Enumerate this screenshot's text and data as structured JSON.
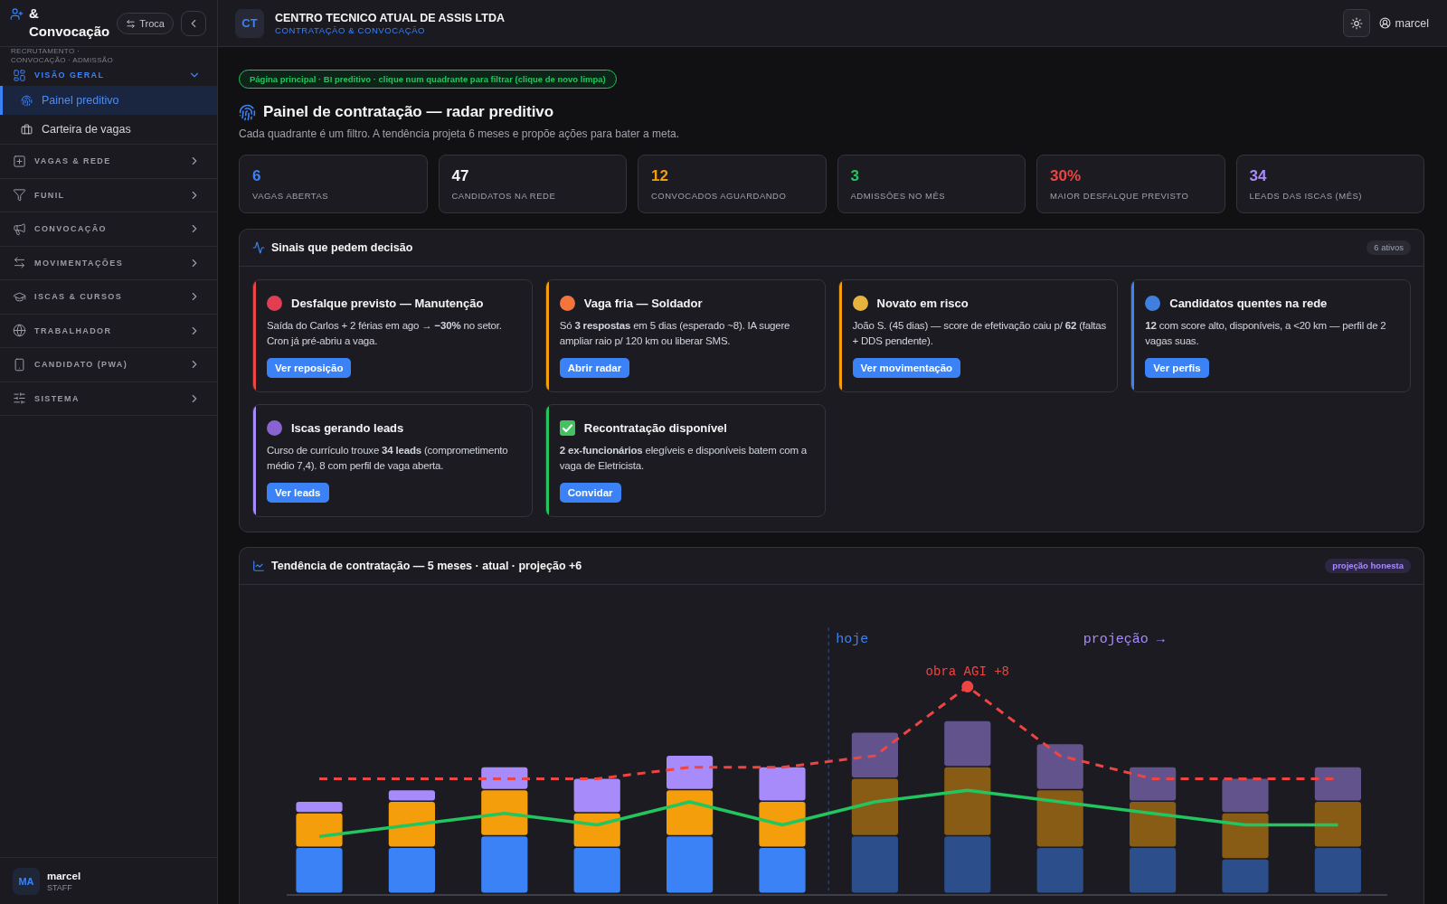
{
  "sidebar": {
    "title": "& Convocação",
    "subtitle": "RECRUTAMENTO · CONVOCAÇÃO · ADMISSÃO",
    "switch_button": "Troca",
    "groups": [
      {
        "label": "VISÃO GERAL",
        "expanded": true,
        "children": [
          {
            "label": "Painel preditivo",
            "selected": true
          },
          {
            "label": "Carteira de vagas",
            "selected": false
          }
        ]
      },
      {
        "label": "VAGAS & REDE",
        "expanded": false
      },
      {
        "label": "FUNIL",
        "expanded": false
      },
      {
        "label": "CONVOCAÇÃO",
        "expanded": false
      },
      {
        "label": "MOVIMENTAÇÕES",
        "expanded": false
      },
      {
        "label": "ISCAS & CURSOS",
        "expanded": false
      },
      {
        "label": "TRABALHADOR",
        "expanded": false
      },
      {
        "label": "CANDIDATO (PWA)",
        "expanded": false
      },
      {
        "label": "SISTEMA",
        "expanded": false
      }
    ],
    "user": {
      "initials": "MA",
      "name": "marcel",
      "role": "STAFF"
    }
  },
  "topbar": {
    "initials": "CT",
    "company": "CENTRO TECNICO ATUAL DE ASSIS LTDA",
    "module": "CONTRATAÇÃO & CONVOCAÇÃO",
    "user": "marcel"
  },
  "page": {
    "breadcrumb": "Página principal · BI preditivo · clique num quadrante para filtrar (clique de novo limpa)",
    "title": "Painel de contratação — radar preditivo",
    "subtitle": "Cada quadrante é um filtro. A tendência projeta 6 meses e propõe ações para bater a meta."
  },
  "stats": [
    {
      "value": "6",
      "label": "VAGAS ABERTAS",
      "color": "#3b82f6"
    },
    {
      "value": "47",
      "label": "CANDIDATOS NA REDE",
      "color": "#f4f4f5"
    },
    {
      "value": "12",
      "label": "CONVOCADOS AGUARDANDO",
      "color": "#f59e0b"
    },
    {
      "value": "3",
      "label": "ADMISSÕES NO MÊS",
      "color": "#22c55e"
    },
    {
      "value": "30%",
      "label": "MAIOR DESFALQUE PREVISTO",
      "color": "#ef4444"
    },
    {
      "value": "34",
      "label": "LEADS DAS ISCAS (MÊS)",
      "color": "#a78bfa"
    }
  ],
  "signals": {
    "title": "Sinais que pedem decisão",
    "badge": "6 ativos",
    "cards": [
      {
        "color": "#ef4444",
        "icon": {
          "kind": "dot",
          "color": "#e23d50"
        },
        "title": "Desfalque previsto — Manutenção",
        "text": "Saída do Carlos + 2 férias em ago → **−30%** no setor. Cron já pré-abriu a vaga.",
        "action": "Ver reposição"
      },
      {
        "color": "#f59e0b",
        "icon": {
          "kind": "dot",
          "color": "#f4743b"
        },
        "title": "Vaga fria — Soldador",
        "text": "Só **3 respostas** em 5 dias (esperado ~8). IA sugere ampliar raio p/ 120 km ou liberar SMS.",
        "action": "Abrir radar"
      },
      {
        "color": "#f59e0b",
        "icon": {
          "kind": "dot",
          "color": "#e8b33c"
        },
        "title": "Novato em risco",
        "text": "João S. (45 dias) — score de efetivação caiu p/ **62** (faltas + DDS pendente).",
        "action": "Ver movimentação"
      },
      {
        "color": "#3b82f6",
        "icon": {
          "kind": "dot",
          "color": "#3f7fe0"
        },
        "title": "Candidatos quentes na rede",
        "text": "**12** com score alto, disponíveis, a <20 km — perfil de 2 vagas suas.",
        "action": "Ver perfis"
      },
      {
        "color": "#a78bfa",
        "icon": {
          "kind": "dot",
          "color": "#8a63d2"
        },
        "title": "Iscas gerando leads",
        "text": "Curso de currículo trouxe **34 leads** (comprometimento médio 7,4). 8 com perfil de vaga aberta.",
        "action": "Ver leads"
      },
      {
        "color": "#22c55e",
        "icon": {
          "kind": "check",
          "color": "#45c160"
        },
        "title": "Recontratação disponível",
        "text": "**2 ex-funcionários** elegíveis e disponíveis batem com a vaga de Eletricista.",
        "action": "Convidar"
      }
    ]
  },
  "trend": {
    "title": "Tendência de contratação — 5 meses · atual · projeção +6",
    "badge": "projeção honesta",
    "chart_labels": [
      {
        "kind": "today",
        "text": "hoje"
      },
      {
        "kind": "projection",
        "text": "projeção →"
      },
      {
        "kind": "peak",
        "text": "obra AGI +8"
      }
    ]
  }
}
